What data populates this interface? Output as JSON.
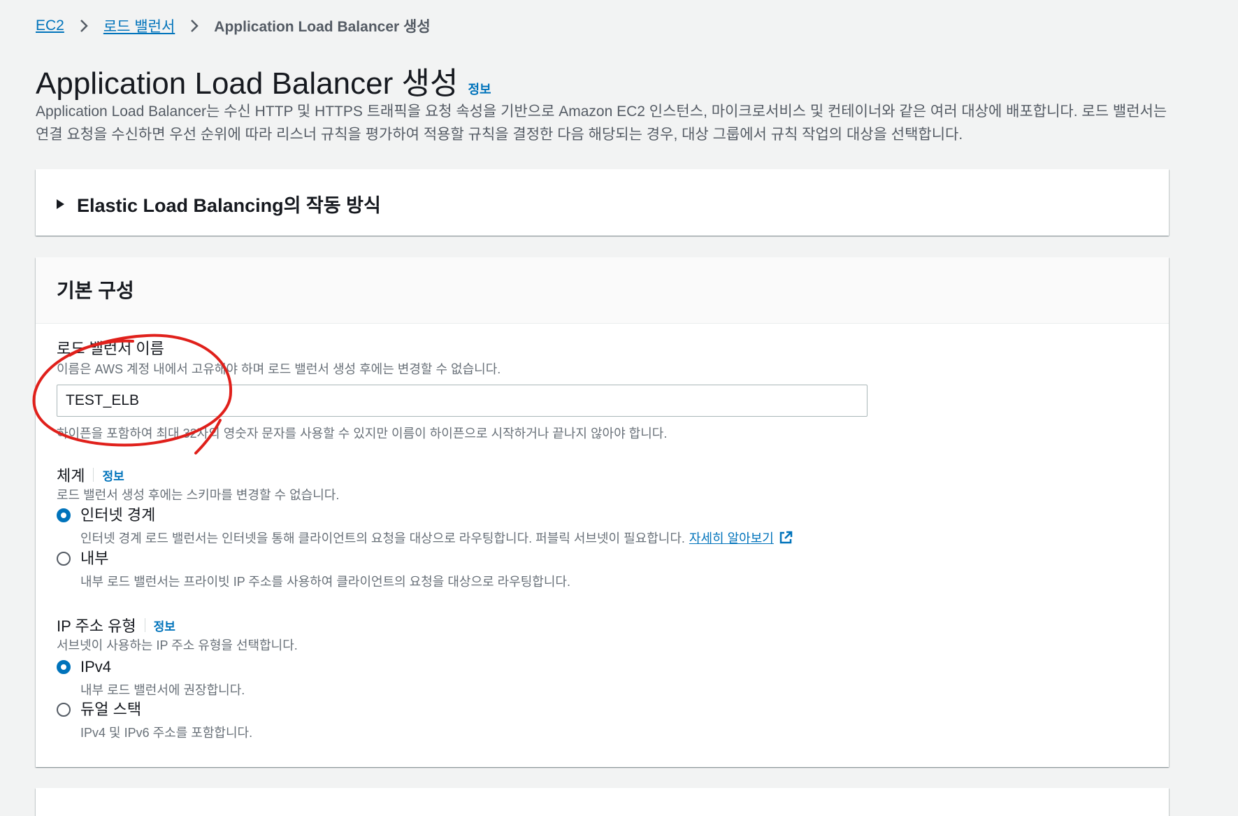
{
  "breadcrumb": {
    "items": [
      "EC2",
      "로드 밸런서"
    ],
    "current": "Application Load Balancer 생성"
  },
  "header": {
    "title": "Application Load Balancer 생성",
    "info": "정보",
    "description": "Application Load Balancer는 수신 HTTP 및 HTTPS 트래픽을 요청 속성을 기반으로 Amazon EC2 인스턴스, 마이크로서비스 및 컨테이너와 같은 여러 대상에 배포합니다. 로드 밸런서는 연결 요청을 수신하면 우선 순위에 따라 리스너 규칙을 평가하여 적용할 규칙을 결정한 다음 해당되는 경우, 대상 그룹에서 규칙 작업의 대상을 선택합니다."
  },
  "expander": {
    "title": "Elastic Load Balancing의 작동 방식"
  },
  "basic_config": {
    "title": "기본 구성",
    "name_field": {
      "label": "로드 밸런서 이름",
      "description": "이름은 AWS 계정 내에서 고유해야 하며 로드 밸런서 생성 후에는 변경할 수 없습니다.",
      "value": "TEST_ELB",
      "constraint": "하이픈을 포함하여 최대 32자의 영숫자 문자를 사용할 수 있지만 이름이 하이픈으로 시작하거나 끝나지 않아야 합니다."
    },
    "scheme": {
      "label": "체계",
      "info": "정보",
      "description": "로드 밸런서 생성 후에는 스키마를 변경할 수 없습니다.",
      "options": [
        {
          "title": "인터넷 경계",
          "description": "인터넷 경계 로드 밸런서는 인터넷을 통해 클라이언트의 요청을 대상으로 라우팅합니다. 퍼블릭 서브넷이 필요합니다.",
          "link": "자세히 알아보기",
          "checked": true
        },
        {
          "title": "내부",
          "description": "내부 로드 밸런서는 프라이빗 IP 주소를 사용하여 클라이언트의 요청을 대상으로 라우팅합니다.",
          "checked": false
        }
      ]
    },
    "ip_type": {
      "label": "IP 주소 유형",
      "info": "정보",
      "description": "서브넷이 사용하는 IP 주소 유형을 선택합니다.",
      "options": [
        {
          "title": "IPv4",
          "description": "내부 로드 밸런서에 권장합니다.",
          "checked": true
        },
        {
          "title": "듀얼 스택",
          "description": "IPv4 및 IPv6 주소를 포함합니다.",
          "checked": false
        }
      ]
    }
  },
  "colors": {
    "link": "#0073bb",
    "annotation": "#e0201b",
    "radio_checked": "#0073bb"
  }
}
